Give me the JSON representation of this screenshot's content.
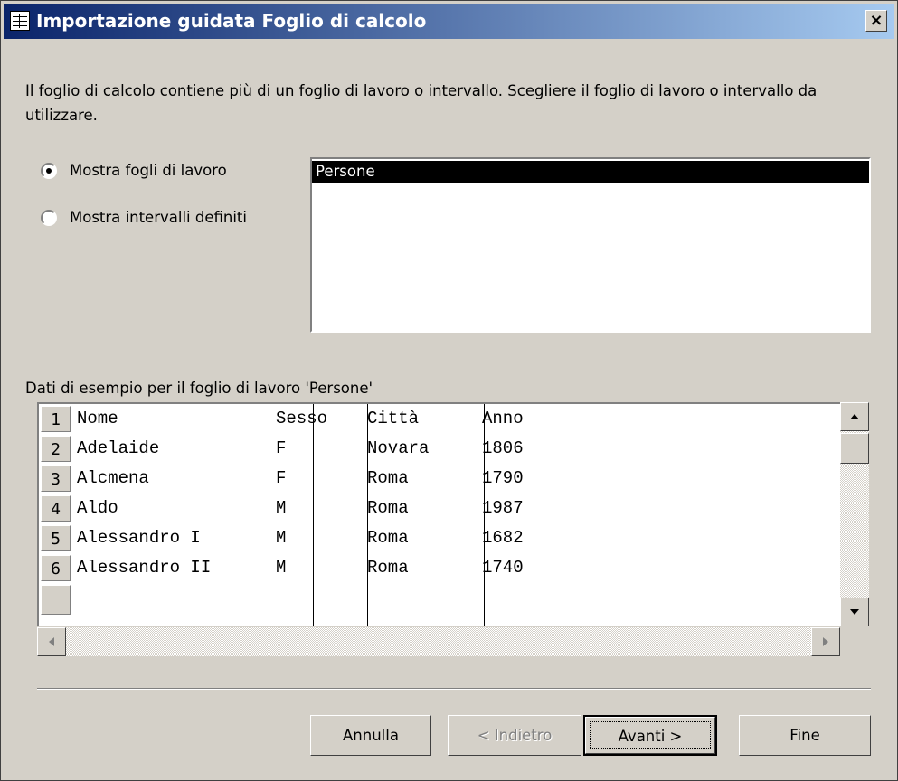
{
  "window": {
    "title": "Importazione guidata Foglio di calcolo",
    "close_label": "×"
  },
  "description": "Il foglio di calcolo contiene più di un foglio di lavoro o intervallo. Scegliere il foglio di lavoro o intervallo da utilizzare.",
  "options": [
    {
      "label": "Mostra fogli di lavoro",
      "selected": true
    },
    {
      "label": "Mostra intervalli definiti",
      "selected": false
    }
  ],
  "sheet_list": {
    "items": [
      "Persone"
    ],
    "selected": "Persone"
  },
  "sample": {
    "label": "Dati di esempio per il foglio di lavoro 'Persone'",
    "rows": [
      {
        "num": "1",
        "cells": [
          "Nome",
          "Sesso",
          "Città",
          "Anno"
        ]
      },
      {
        "num": "2",
        "cells": [
          "Adelaide",
          "F",
          "Novara",
          "1806"
        ]
      },
      {
        "num": "3",
        "cells": [
          "Alcmena",
          "F",
          "Roma",
          "1790"
        ]
      },
      {
        "num": "4",
        "cells": [
          "Aldo",
          "M",
          "Roma",
          "1987"
        ]
      },
      {
        "num": "5",
        "cells": [
          "Alessandro I",
          "M",
          "Roma",
          "1682"
        ]
      },
      {
        "num": "6",
        "cells": [
          "Alessandro II",
          "M",
          "Roma",
          "1740"
        ]
      }
    ]
  },
  "buttons": {
    "annulla": "Annulla",
    "indietro": "< Indietro",
    "avanti": "Avanti >",
    "fine": "Fine"
  },
  "icons": {
    "window": "table-icon",
    "up": "arrow-up-icon",
    "down": "arrow-down-icon",
    "left": "arrow-left-icon",
    "right": "arrow-right-icon"
  }
}
